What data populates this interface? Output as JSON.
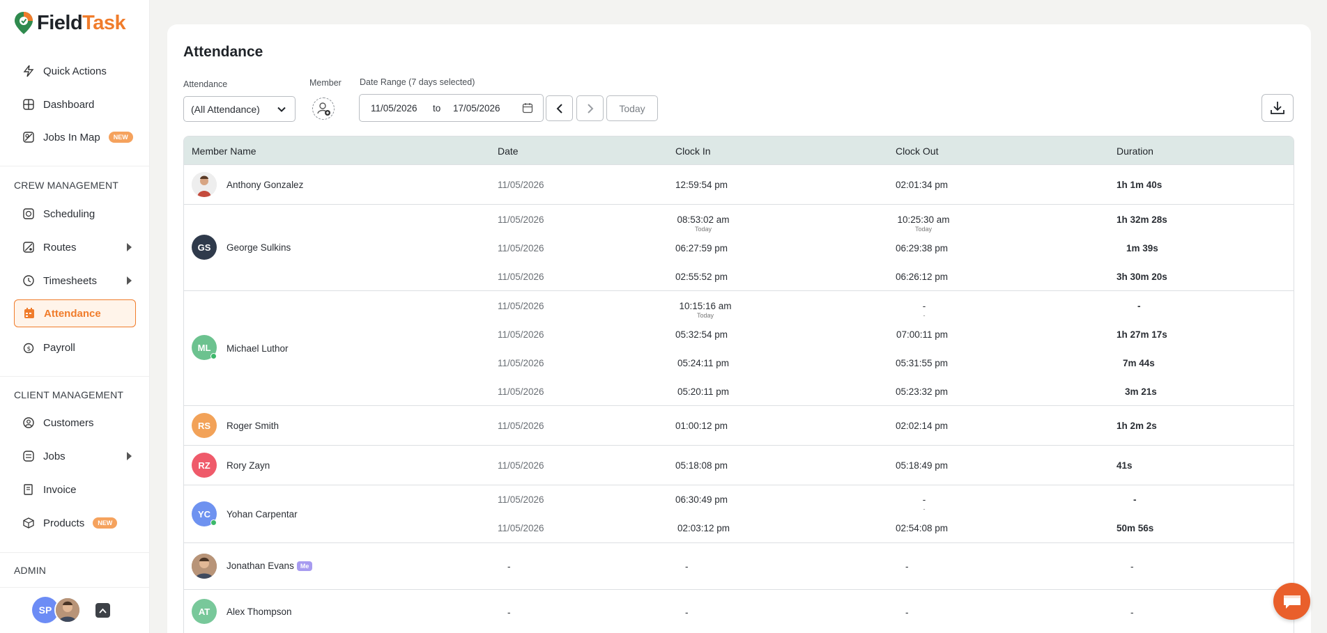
{
  "app": {
    "logo_a": "Field",
    "logo_b": "Task"
  },
  "sidebar": {
    "quick_actions": "Quick Actions",
    "dashboard": "Dashboard",
    "jobs_in_map": "Jobs In Map",
    "new_badge": "NEW",
    "crew_section": "CREW MANAGEMENT",
    "scheduling": "Scheduling",
    "routes": "Routes",
    "timesheets": "Timesheets",
    "attendance": "Attendance",
    "payroll": "Payroll",
    "client_section": "CLIENT MANAGEMENT",
    "customers": "Customers",
    "jobs": "Jobs",
    "invoice": "Invoice",
    "products": "Products",
    "admin_section": "ADMIN",
    "user_initials": "SP"
  },
  "page": {
    "title": "Attendance",
    "attendance_label": "Attendance",
    "attendance_value": "(All Attendance)",
    "member_label": "Member",
    "date_range_label": "Date Range (7 days selected)",
    "date_from": "11/05/2026",
    "date_to_word": "to",
    "date_to": "17/05/2026",
    "today": "Today"
  },
  "table": {
    "headers": {
      "member": "Member Name",
      "date": "Date",
      "clock_in": "Clock In",
      "clock_out": "Clock Out",
      "duration": "Duration"
    },
    "rows": [
      {
        "name": "Anthony Gonzalez",
        "entries": [
          {
            "date": "11/05/2026",
            "in": "12:59:54 pm",
            "out": "02:01:34 pm",
            "dur": "1h 1m 40s"
          }
        ]
      },
      {
        "name": "George Sulkins",
        "initials": "GS",
        "entries": [
          {
            "date": "11/05/2026",
            "in": "08:53:02 am",
            "in_sub": "Today",
            "out": "10:25:30 am",
            "out_sub": "Today",
            "dur": "1h 32m 28s"
          },
          {
            "date": "11/05/2026",
            "in": "06:27:59 pm",
            "out": "06:29:38 pm",
            "dur": "1m 39s"
          },
          {
            "date": "11/05/2026",
            "in": "02:55:52 pm",
            "out": "06:26:12 pm",
            "dur": "3h 30m 20s"
          }
        ]
      },
      {
        "name": "Michael Luthor",
        "initials": "ML",
        "entries": [
          {
            "date": "11/05/2026",
            "in": "10:15:16 am",
            "in_sub": "Today",
            "out": "-",
            "out_sub": "-",
            "dur": "-"
          },
          {
            "date": "11/05/2026",
            "in": "05:32:54 pm",
            "out": "07:00:11 pm",
            "dur": "1h 27m 17s"
          },
          {
            "date": "11/05/2026",
            "in": "05:24:11 pm",
            "out": "05:31:55 pm",
            "dur": "7m 44s"
          },
          {
            "date": "11/05/2026",
            "in": "05:20:11 pm",
            "out": "05:23:32 pm",
            "dur": "3m 21s"
          }
        ]
      },
      {
        "name": "Roger Smith",
        "initials": "RS",
        "entries": [
          {
            "date": "11/05/2026",
            "in": "01:00:12 pm",
            "out": "02:02:14 pm",
            "dur": "1h 2m 2s"
          }
        ]
      },
      {
        "name": "Rory Zayn",
        "initials": "RZ",
        "entries": [
          {
            "date": "11/05/2026",
            "in": "05:18:08 pm",
            "out": "05:18:49 pm",
            "dur": "41s"
          }
        ]
      },
      {
        "name": "Yohan Carpentar",
        "initials": "YC",
        "entries": [
          {
            "date": "11/05/2026",
            "in": "06:30:49 pm",
            "out": "-",
            "out_sub": "-",
            "dur": "-"
          },
          {
            "date": "11/05/2026",
            "in": "02:03:12 pm",
            "out": "02:54:08 pm",
            "dur": "50m 56s"
          }
        ]
      },
      {
        "name": "Jonathan Evans",
        "me_badge": "Me",
        "entries": [
          {
            "date": "-",
            "in": "-",
            "out": "-",
            "dur": "-"
          }
        ]
      },
      {
        "name": "Alex Thompson",
        "initials": "AT",
        "entries": [
          {
            "date": "-",
            "in": "-",
            "out": "-",
            "dur": "-"
          }
        ]
      }
    ]
  },
  "colors": {
    "accent": "#f07c2b",
    "header_bg": "#dde8e6",
    "gs": "#2f3a4b",
    "ml": "#6cc28f",
    "rs": "#f2a258",
    "rz": "#ef5a6a",
    "yc": "#6e92f0",
    "at": "#78c89a"
  }
}
